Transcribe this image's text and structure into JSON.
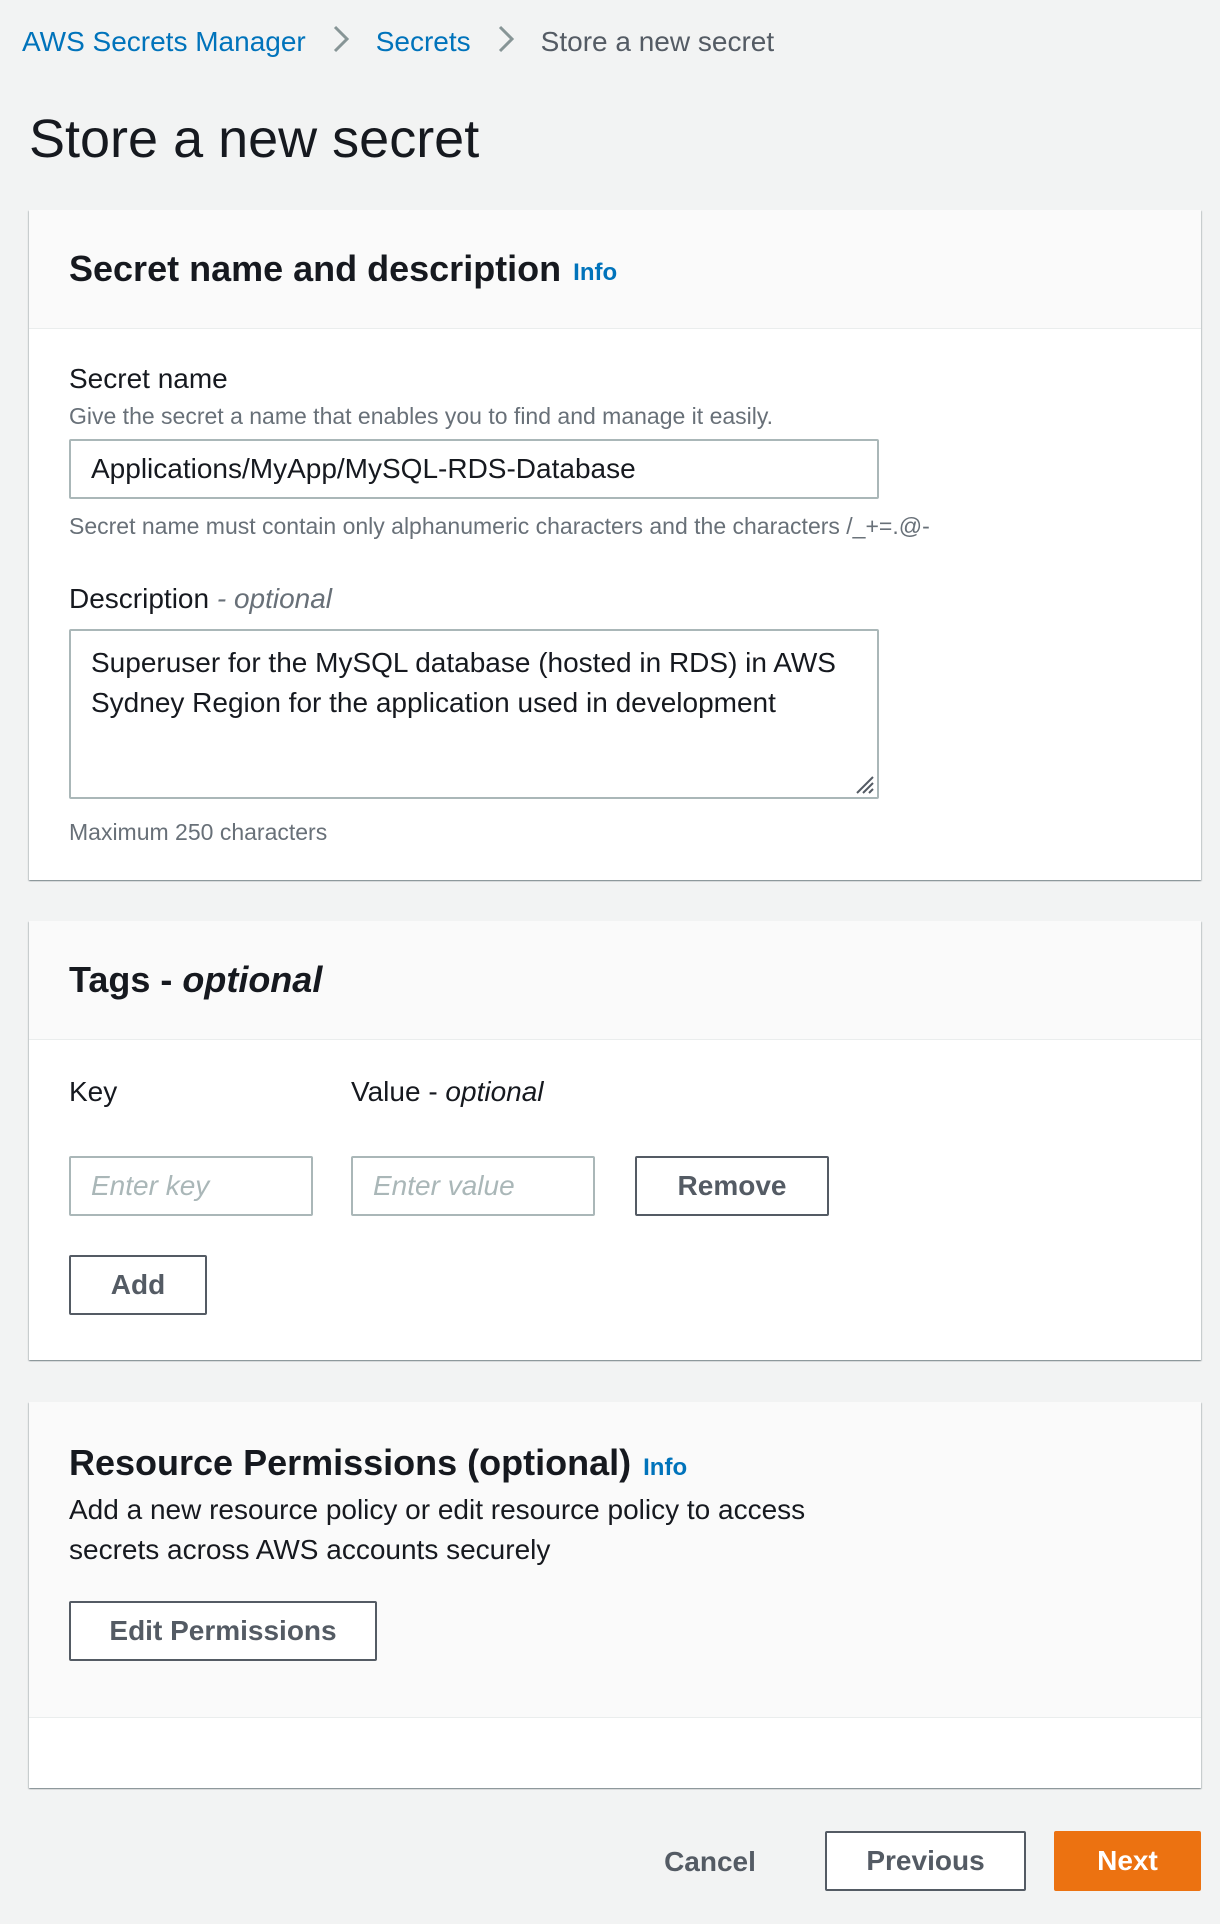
{
  "breadcrumb": {
    "items": [
      "AWS Secrets Manager",
      "Secrets"
    ],
    "current": "Store a new secret"
  },
  "page": {
    "title": "Store a new secret"
  },
  "secret_section": {
    "title": "Secret name and description",
    "info": "Info",
    "name_label": "Secret name",
    "name_description": "Give the secret a name that enables you to find and manage it easily.",
    "name_value": "Applications/MyApp/MySQL-RDS-Database",
    "name_constraint": "Secret name must contain only alphanumeric characters and the characters /_+=.@-",
    "description_label": "Description",
    "description_optional": "- optional",
    "description_value": "Superuser for the MySQL database (hosted in RDS) in AWS Sydney Region for the application used in development",
    "description_constraint": "Maximum 250 characters"
  },
  "tags_section": {
    "title": "Tags - ",
    "title_optional": "optional",
    "key_label": "Key",
    "value_label": "Value - ",
    "value_optional": "optional",
    "key_placeholder": "Enter key",
    "value_placeholder": "Enter value",
    "remove_label": "Remove",
    "add_label": "Add"
  },
  "permissions_section": {
    "title": "Resource Permissions (optional)",
    "info": "Info",
    "description": "Add a new resource policy or edit resource policy to access secrets across AWS accounts securely",
    "edit_label": "Edit Permissions"
  },
  "footer": {
    "cancel_label": "Cancel",
    "previous_label": "Previous",
    "next_label": "Next"
  },
  "colors": {
    "accent": "#ec7211",
    "link": "#0073bb",
    "background": "#f2f3f3"
  }
}
